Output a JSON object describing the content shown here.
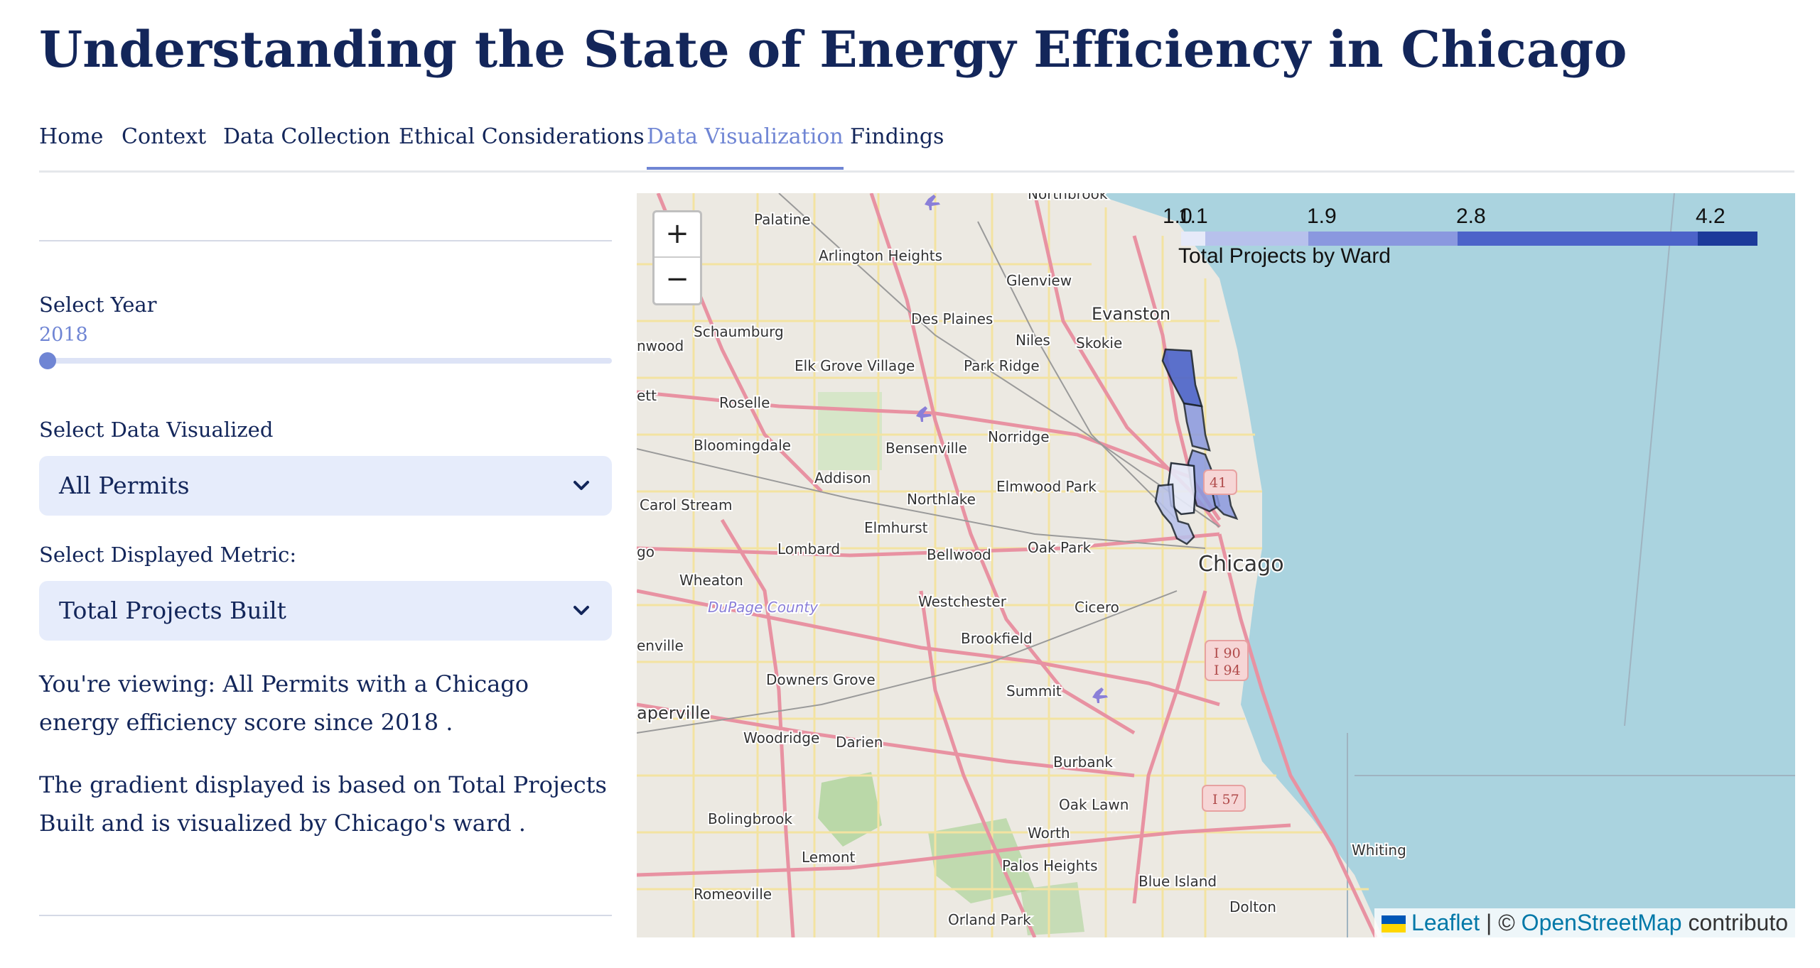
{
  "page": {
    "title": "Understanding the State of Energy Efficiency in Chicago"
  },
  "nav": {
    "items": [
      {
        "label": "Home",
        "active": false
      },
      {
        "label": "Context",
        "active": false
      },
      {
        "label": "Data Collection",
        "active": false
      },
      {
        "label": "Ethical Considerations",
        "active": false
      },
      {
        "label": "Data Visualization",
        "active": true
      },
      {
        "label": "Findings",
        "active": false
      }
    ]
  },
  "controls": {
    "year_label": "Select Year",
    "year_value": "2018",
    "year_slider_fraction": 0.0,
    "data_label": "Select Data Visualized",
    "data_selected": "All Permits",
    "metric_label": "Select Displayed Metric:",
    "metric_selected": "Total Projects Built"
  },
  "summary": {
    "line1": "You're viewing: All Permits with a Chicago energy efficiency score since 2018 .",
    "line2": "The gradient displayed is based on Total Projects Built and is visualized by Chicago's ward ."
  },
  "map": {
    "zoom_in": "+",
    "zoom_out": "−",
    "legend": {
      "title": "Total Projects by Ward",
      "ticks": [
        "1.0",
        "1.1",
        "1.9",
        "2.8",
        "4.2"
      ],
      "colors": [
        "#e6eaf9",
        "#b7c1ec",
        "#8a98df",
        "#4c63c9",
        "#1c3a9a"
      ]
    },
    "labels": {
      "chicago": "Chicago",
      "evanston": "Evanston",
      "palatine": "Palatine",
      "arlington_heights": "Arlington Heights",
      "glenview": "Glenview",
      "northbrook": "Northbrook",
      "des_plaines": "Des Plaines",
      "niles": "Niles",
      "skokie": "Skokie",
      "schaumburg": "Schaumburg",
      "elk_grove": "Elk Grove Village",
      "park_ridge": "Park Ridge",
      "roselle": "Roselle",
      "bloomingdale": "Bloomingdale",
      "bensenville": "Bensenville",
      "norridge": "Norridge",
      "addison": "Addison",
      "elmwood_park": "Elmwood Park",
      "carol_stream": "Carol Stream",
      "northlake": "Northlake",
      "elmhurst": "Elmhurst",
      "lombard": "Lombard",
      "bellwood": "Bellwood",
      "oak_park": "Oak Park",
      "wheaton": "Wheaton",
      "westchester": "Westchester",
      "cicero": "Cicero",
      "dupage": "DuPage County",
      "brookfield": "Brookfield",
      "downers_grove": "Downers Grove",
      "summit": "Summit",
      "naperville": "aperville",
      "woodridge": "Woodridge",
      "darien": "Darien",
      "burbank": "Burbank",
      "bolingbrook": "Bolingbrook",
      "oak_lawn": "Oak Lawn",
      "worth": "Worth",
      "lemont": "Lemont",
      "palos_heights": "Palos Heights",
      "blue_island": "Blue Island",
      "romeoville": "Romeoville",
      "orland_park": "Orland Park",
      "dolton": "Dolton",
      "whiting": "Whiting",
      "hwood": "nwood",
      "ett": "ett",
      "go": "go",
      "enville": "enville",
      "i90": "I 90",
      "i94": "I 94",
      "i57": "I 57",
      "i41": "41"
    },
    "attribution": {
      "leaflet": "Leaflet",
      "separator": " | © ",
      "osm": "OpenStreetMap",
      "contributors": " contributo"
    }
  }
}
